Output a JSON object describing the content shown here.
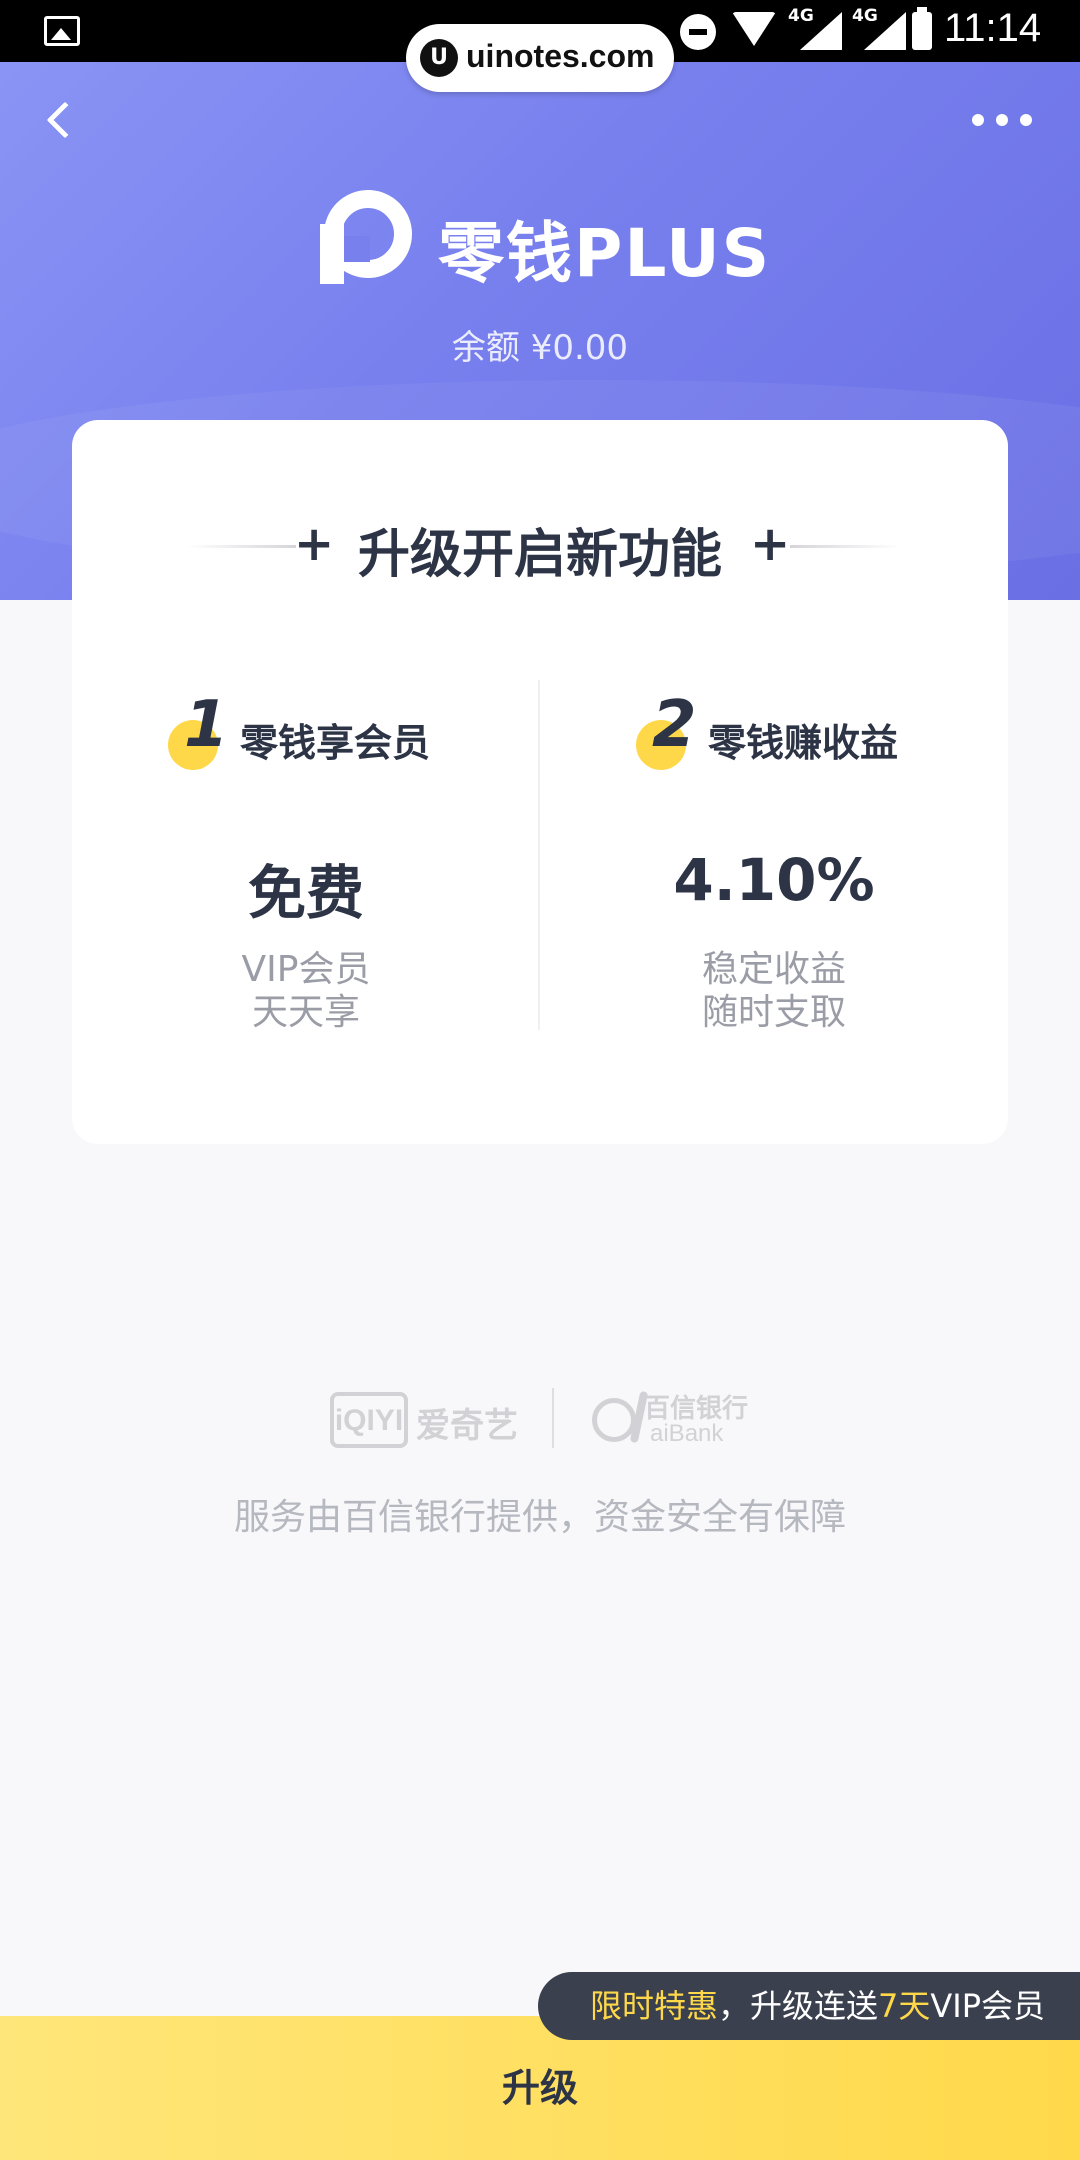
{
  "status_bar": {
    "time": "11:14",
    "network_1": "4G",
    "network_2": "4G"
  },
  "watermark": {
    "logo": "U",
    "text": "uinotes.com"
  },
  "header": {
    "brand": "零钱PLUS",
    "balance": "余额 ¥0.00",
    "colors": {
      "gradient_start": "#8b96f5",
      "gradient_end": "#6a6fe4"
    }
  },
  "card": {
    "title": "升级开启新功能",
    "features": [
      {
        "num": "1",
        "label": "零钱享会员",
        "big": "免费",
        "sub1": "VIP会员",
        "sub2": "天天享"
      },
      {
        "num": "2",
        "label": "零钱赚收益",
        "big": "4.10%",
        "sub1": "稳定收益",
        "sub2": "随时支取"
      }
    ]
  },
  "partners": {
    "iqiyi_logo": "iQIYI",
    "iqiyi_name": "爱奇艺",
    "aibank_cn": "百信银行",
    "aibank_en": "aiBank"
  },
  "footer_text": "服务由百信银行提供，资金安全有保障",
  "promo": {
    "highlight": "限时特惠",
    "text_1": "，升级连送",
    "days": "7天",
    "text_2": "VIP会员"
  },
  "cta": {
    "label": "升级",
    "color": "#ffd94a"
  }
}
